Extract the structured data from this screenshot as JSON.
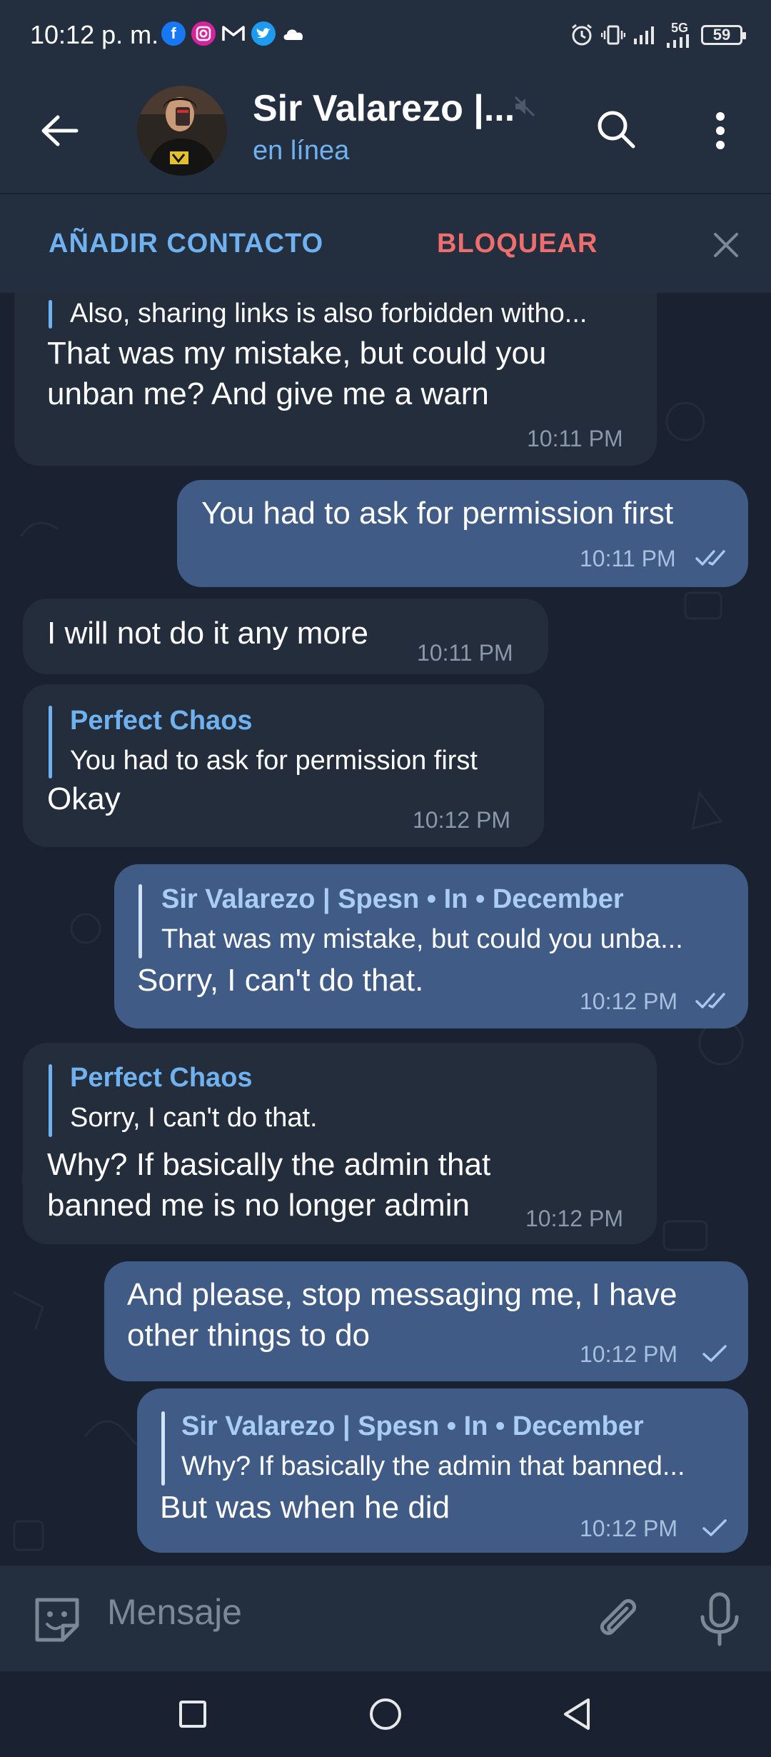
{
  "status_bar": {
    "time": "10:12 p. m.",
    "battery": "59",
    "network": "5G"
  },
  "header": {
    "title": "Sir Valarezo |...",
    "status": "en línea"
  },
  "action_bar": {
    "add_contact": "AÑADIR CONTACTO",
    "block": "BLOQUEAR"
  },
  "messages": [
    {
      "direction": "in",
      "reply_text": "Also, sharing links is also forbidden witho...",
      "text_lines": [
        "That was my mistake, but could you",
        "unban me? And give me a warn"
      ],
      "time": "10:11 PM"
    },
    {
      "direction": "out",
      "text_lines": [
        "You had to ask for permission first"
      ],
      "time": "10:11 PM",
      "status": "read"
    },
    {
      "direction": "in",
      "text_lines": [
        "I will not do it any more"
      ],
      "time": "10:11 PM"
    },
    {
      "direction": "in",
      "reply_name": "Perfect Chaos",
      "reply_text": "You had to ask for permission first",
      "text_lines": [
        "Okay"
      ],
      "time": "10:12 PM"
    },
    {
      "direction": "out",
      "reply_name": "Sir Valarezo | Spesn • In • December",
      "reply_text": "That was my mistake, but could you unba...",
      "text_lines": [
        "Sorry, I can't do that."
      ],
      "time": "10:12 PM",
      "status": "read"
    },
    {
      "direction": "in",
      "reply_name": "Perfect Chaos",
      "reply_text": "Sorry, I can't do that.",
      "text_lines": [
        "Why? If basically the admin that",
        "banned me is no longer admin"
      ],
      "time": "10:12 PM"
    },
    {
      "direction": "out",
      "text_lines": [
        "And please, stop messaging me, I have",
        "other things to do"
      ],
      "time": "10:12 PM",
      "status": "sent"
    },
    {
      "direction": "out",
      "reply_name": "Sir Valarezo | Spesn • In • December",
      "reply_text": "Why? If basically the admin that banned...",
      "text_lines": [
        "But was when he did"
      ],
      "time": "10:12 PM",
      "status": "sent"
    }
  ],
  "input": {
    "placeholder": "Mensaje"
  },
  "colors": {
    "background": "#1a2231",
    "bar": "#232f3f",
    "incoming_bubble": "#242d3c",
    "outgoing_bubble": "#3f5b86",
    "accent": "#6fb2ef",
    "danger": "#ee6d6d"
  },
  "icons": [
    "back-arrow-icon",
    "mute-icon",
    "search-icon",
    "more-vertical-icon",
    "close-icon",
    "sticker-emoji-icon",
    "paperclip-icon",
    "microphone-icon",
    "double-check-icon",
    "single-check-icon"
  ]
}
